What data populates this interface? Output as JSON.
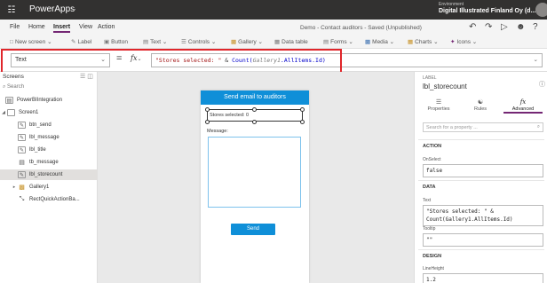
{
  "app": {
    "name": "PowerApps",
    "environment_label": "Environment",
    "environment_name": "Digital Illustrated Finland Oy (d..."
  },
  "menu": {
    "items": [
      "File",
      "Home",
      "Insert",
      "View",
      "Action"
    ],
    "active": "Insert",
    "save_status": "Demo - Contact auditors - Saved (Unpublished)"
  },
  "ribbon": {
    "new_screen": "New screen",
    "label": "Label",
    "button": "Button",
    "text": "Text",
    "controls": "Controls",
    "gallery": "Gallery",
    "data_table": "Data table",
    "forms": "Forms",
    "media": "Media",
    "charts": "Charts",
    "icons": "Icons"
  },
  "formula_bar": {
    "property": "Text",
    "equals": "=",
    "fx": "fx",
    "formula_string": "\"Stores selected: \"",
    "formula_amp": " & ",
    "formula_fn": "Count(",
    "formula_gallery": "Gallery1",
    "formula_rest": ".AllItems.Id)"
  },
  "tree": {
    "header": "Screens",
    "search_placeholder": "Search",
    "items": [
      {
        "label": "PowerBIIntegration",
        "icon": "powerbi-icon"
      },
      {
        "label": "Screen1",
        "icon": "screen-icon"
      },
      {
        "label": "btn_send",
        "icon": "button-icon"
      },
      {
        "label": "lbl_message",
        "icon": "label-icon"
      },
      {
        "label": "lbl_title",
        "icon": "label-icon"
      },
      {
        "label": "tb_message",
        "icon": "textbox-icon"
      },
      {
        "label": "lbl_storecount",
        "icon": "label-icon",
        "selected": true
      },
      {
        "label": "Gallery1",
        "icon": "gallery-icon"
      },
      {
        "label": "RectQuickActionBa...",
        "icon": "rectangle-icon"
      }
    ]
  },
  "canvas": {
    "title": "Send email to auditors",
    "count_label": "Stores selected: 0",
    "message_label": "Message:",
    "send_button": "Send"
  },
  "properties": {
    "label_caption": "LABEL",
    "control_name": "lbl_storecount",
    "tabs": [
      "Properties",
      "Rules",
      "Advanced"
    ],
    "active_tab": "Advanced",
    "search_placeholder": "Search for a property ...",
    "action_section": "ACTION",
    "onselect_label": "OnSelect",
    "onselect_value": "false",
    "data_section": "DATA",
    "text_label": "Text",
    "text_value_1": "\"Stores selected: \" &",
    "text_value_2": "Count(Gallery1.AllItems.Id)",
    "tooltip_label": "Tooltip",
    "tooltip_value": "\"\"",
    "design_section": "DESIGN",
    "lineheight_label": "LineHeight",
    "lineheight_value": "1.2"
  },
  "colors": {
    "appbar": "#323130",
    "accent": "#742774",
    "screen_header": "#0f8fd8",
    "highlight_border": "#e0262b"
  }
}
